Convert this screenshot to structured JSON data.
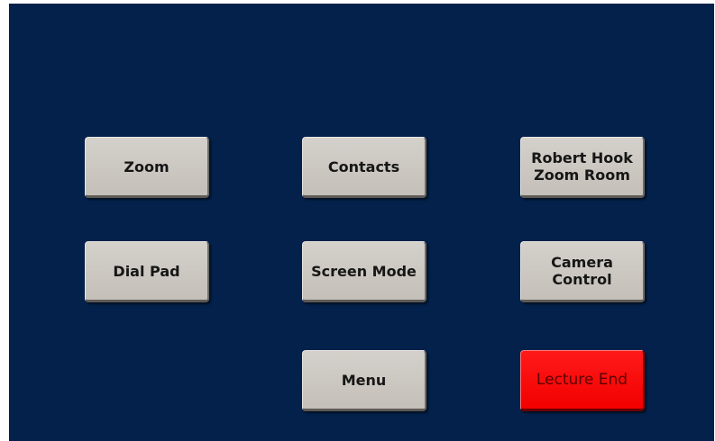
{
  "panel": {
    "background_color": "#03214a",
    "button_color": "#cdc9c4",
    "alert_button_color": "#ff0000"
  },
  "buttons": {
    "zoom": "Zoom",
    "contacts": "Contacts",
    "robert_hook_zoom_room": "Robert Hook\nZoom Room",
    "dial_pad": "Dial Pad",
    "screen_mode": "Screen Mode",
    "camera_control": "Camera\nControl",
    "menu": "Menu",
    "lecture_end": "Lecture End"
  }
}
